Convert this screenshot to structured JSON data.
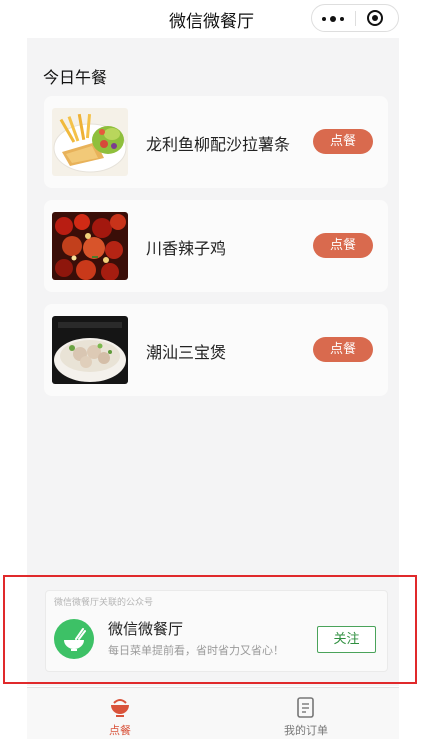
{
  "app": {
    "title": "微信微餐厅"
  },
  "menu": {
    "section_title": "今日午餐",
    "items": [
      {
        "name": "龙利鱼柳配沙拉薯条",
        "button_label": "点餐",
        "photo": "fish-fillet-salad-fries-photo"
      },
      {
        "name": "川香辣子鸡",
        "button_label": "点餐",
        "photo": "sichuan-spicy-chicken-photo"
      },
      {
        "name": "潮汕三宝煲",
        "button_label": "点餐",
        "photo": "chaoshan-meatball-soup-photo"
      }
    ]
  },
  "official_account": {
    "caption": "微信微餐厅关联的公众号",
    "name": "微信微餐厅",
    "description": "每日菜单提前看，省时省力又省心！",
    "follow_label": "关注",
    "avatar_icon": "noodle-bowl-icon"
  },
  "tabbar": {
    "tabs": [
      {
        "label": "点餐",
        "icon": "bowl-icon",
        "active": true
      },
      {
        "label": "我的订单",
        "icon": "document-icon",
        "active": false
      }
    ]
  },
  "colors": {
    "accent": "#d96a4e",
    "tab_active": "#d9533b",
    "follow_green": "#2f8f3f",
    "avatar_green": "#3dc166",
    "highlight_red": "#e0292b"
  }
}
